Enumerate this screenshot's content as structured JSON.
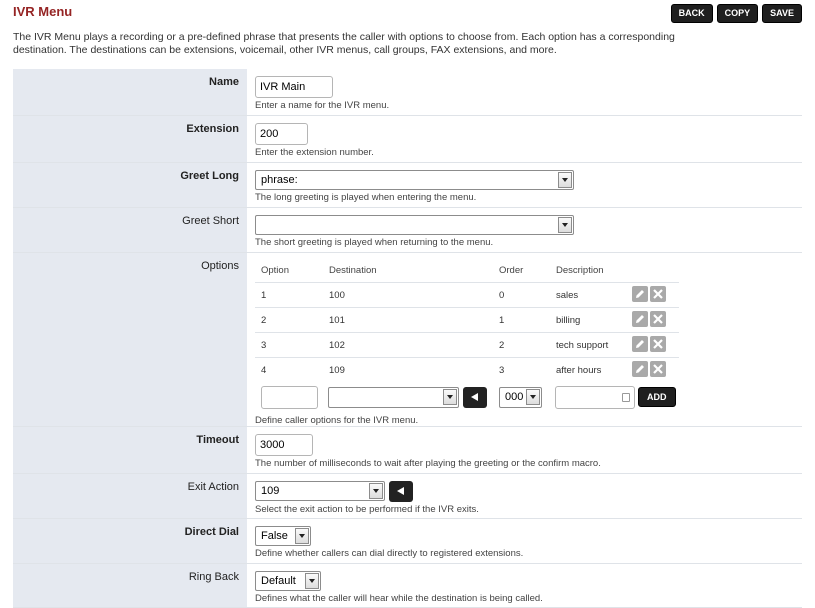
{
  "header": {
    "title": "IVR Menu",
    "buttons": {
      "back": "BACK",
      "copy": "COPY",
      "save": "SAVE"
    },
    "description": "The IVR Menu plays a recording or a pre-defined phrase that presents the caller with options to choose from. Each option has a corresponding destination. The destinations can be extensions, voicemail, other IVR menus, call groups, FAX extensions, and more."
  },
  "form": {
    "name": {
      "label": "Name",
      "value": "IVR Main",
      "hint": "Enter a name for the IVR menu."
    },
    "extension": {
      "label": "Extension",
      "value": "200",
      "hint": "Enter the extension number."
    },
    "greet_long": {
      "label": "Greet Long",
      "value": "phrase:",
      "hint": "The long greeting is played when entering the menu."
    },
    "greet_short": {
      "label": "Greet Short",
      "value": "",
      "hint": "The short greeting is played when returning to the menu."
    },
    "options": {
      "label": "Options",
      "columns": {
        "option": "Option",
        "destination": "Destination",
        "order": "Order",
        "description": "Description"
      },
      "rows": [
        {
          "option": "1",
          "destination": "100",
          "order": "0",
          "description": "sales"
        },
        {
          "option": "2",
          "destination": "101",
          "order": "1",
          "description": "billing"
        },
        {
          "option": "3",
          "destination": "102",
          "order": "2",
          "description": "tech support"
        },
        {
          "option": "4",
          "destination": "109",
          "order": "3",
          "description": "after hours"
        }
      ],
      "new_order_value": "000",
      "add_label": "ADD",
      "hint": "Define caller options for the IVR menu."
    },
    "timeout": {
      "label": "Timeout",
      "value": "3000",
      "hint": "The number of milliseconds to wait after playing the greeting or the confirm macro."
    },
    "exit_action": {
      "label": "Exit Action",
      "value": "109",
      "hint": "Select the exit action to be performed if the IVR exits."
    },
    "direct_dial": {
      "label": "Direct Dial",
      "value": "False",
      "hint": "Define whether callers can dial directly to registered extensions."
    },
    "ring_back": {
      "label": "Ring Back",
      "value": "Default",
      "hint": "Defines what the caller will hear while the destination is being called."
    }
  },
  "icons": {
    "edit": "pencil-icon",
    "delete": "x-icon"
  },
  "colors": {
    "title": "#952424",
    "label_bg": "#e5e9f0",
    "button_bg": "#1f1f1f"
  }
}
